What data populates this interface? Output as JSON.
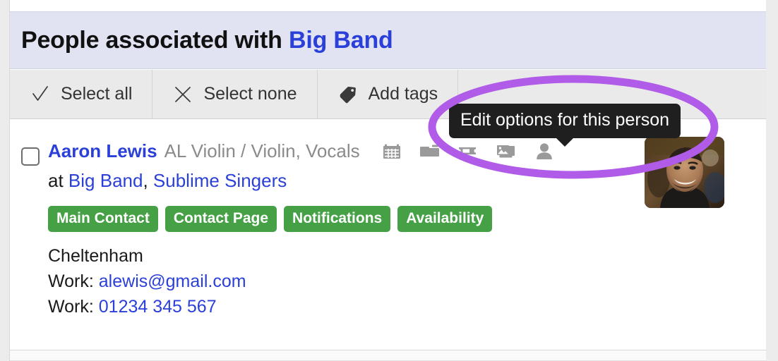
{
  "header": {
    "title_prefix": "People associated with",
    "band_name": "Big Band"
  },
  "toolbar": {
    "buttons": [
      {
        "label": "Select all",
        "icon": "check-icon"
      },
      {
        "label": "Select none",
        "icon": "close-x-icon"
      },
      {
        "label": "Add tags",
        "icon": "tag-icon"
      }
    ]
  },
  "tooltip": {
    "text": "Edit options for this person"
  },
  "person": {
    "name": "Aaron Lewis",
    "role": "AL Violin / Violin, Vocals",
    "at_label": "at",
    "orgs": [
      "Big Band",
      "Sublime Singers"
    ],
    "org_separator": ",",
    "badges": [
      "Main Contact",
      "Contact Page",
      "Notifications",
      "Availability"
    ],
    "location": "Cheltenham",
    "contacts": [
      {
        "label": "Work:",
        "value": "alewis@gmail.com"
      },
      {
        "label": "Work:",
        "value": "01234 345 567"
      }
    ],
    "action_icons": [
      "calendar-icon",
      "folder-icon",
      "ticket-icon",
      "photos-icon",
      "person-icon"
    ]
  },
  "colors": {
    "link": "#2b40d8",
    "badge_green": "#46a046",
    "header_band": "#e1e3f2",
    "toolbar": "#eaeaea",
    "tooltip_bg": "#1f1f1f",
    "annotation_purple": "#b05ce8",
    "icon_gray": "#9a9a9a"
  }
}
